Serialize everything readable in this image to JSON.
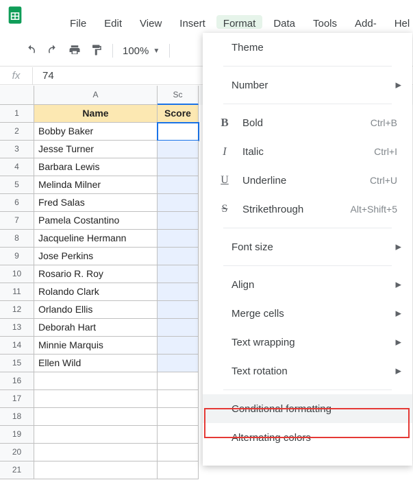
{
  "menubar": {
    "file": "File",
    "edit": "Edit",
    "view": "View",
    "insert": "Insert",
    "format": "Format",
    "data": "Data",
    "tools": "Tools",
    "addons": "Add-ons",
    "help": "Hel"
  },
  "toolbar": {
    "zoom": "100%"
  },
  "formula_bar": {
    "label": "fx",
    "value": "74"
  },
  "columns": {
    "A": "A",
    "B": "Sc"
  },
  "headers": {
    "name": "Name",
    "score": "Score"
  },
  "rows": [
    {
      "n": "1",
      "a_is_header": true
    },
    {
      "n": "2",
      "a": "Bobby Baker"
    },
    {
      "n": "3",
      "a": "Jesse Turner"
    },
    {
      "n": "4",
      "a": "Barbara Lewis"
    },
    {
      "n": "5",
      "a": "Melinda Milner"
    },
    {
      "n": "6",
      "a": "Fred Salas"
    },
    {
      "n": "7",
      "a": "Pamela Costantino"
    },
    {
      "n": "8",
      "a": "Jacqueline Hermann"
    },
    {
      "n": "9",
      "a": "Jose Perkins"
    },
    {
      "n": "10",
      "a": "Rosario R. Roy"
    },
    {
      "n": "11",
      "a": "Rolando Clark"
    },
    {
      "n": "12",
      "a": "Orlando Ellis"
    },
    {
      "n": "13",
      "a": "Deborah Hart"
    },
    {
      "n": "14",
      "a": "Minnie Marquis"
    },
    {
      "n": "15",
      "a": "Ellen Wild"
    },
    {
      "n": "16",
      "a": ""
    },
    {
      "n": "17",
      "a": ""
    },
    {
      "n": "18",
      "a": ""
    },
    {
      "n": "19",
      "a": ""
    },
    {
      "n": "20",
      "a": ""
    },
    {
      "n": "21",
      "a": ""
    }
  ],
  "menu": {
    "theme": "Theme",
    "number": "Number",
    "bold": "Bold",
    "bold_sc": "Ctrl+B",
    "italic": "Italic",
    "italic_sc": "Ctrl+I",
    "underline": "Underline",
    "underline_sc": "Ctrl+U",
    "strike": "Strikethrough",
    "strike_sc": "Alt+Shift+5",
    "fontsize": "Font size",
    "align": "Align",
    "merge": "Merge cells",
    "wrap": "Text wrapping",
    "rotation": "Text rotation",
    "cond": "Conditional formatting",
    "alt": "Alternating colors"
  }
}
